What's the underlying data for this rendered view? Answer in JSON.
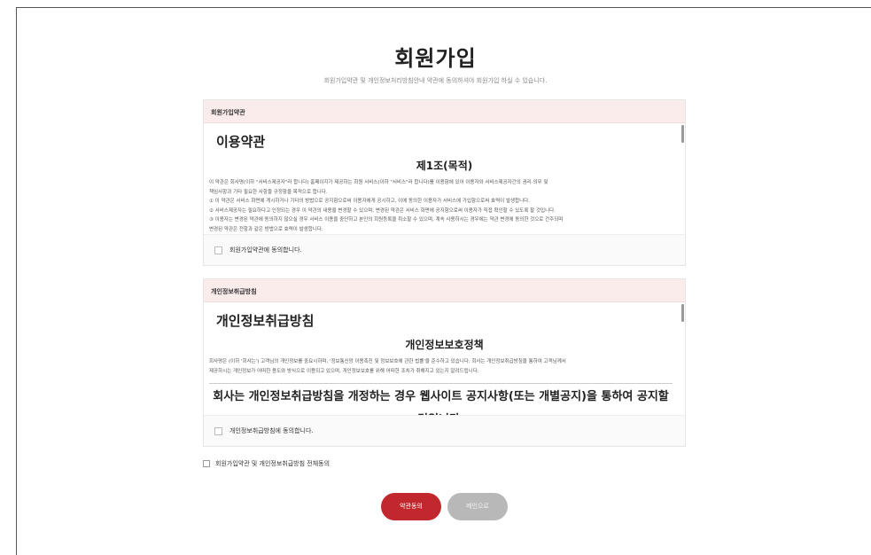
{
  "header": {
    "title": "회원가입",
    "subtitle": "회원가입약관 및 개인정보처리방침안내 약관에 동의하셔야 회원가입 하실 수 있습니다."
  },
  "terms": {
    "section_label": "회원가입약관",
    "doc_title": "이용약관",
    "article_title": "제1조(목적)",
    "lines": [
      "이 약관은 회사명(이하 \"서비스제공자\"라 합니다) 홈페이지가 제공하는 회원 서비스(이하 \"서비스\"라 합니다)를 이용함에 있어 이용자와 서비스제공자간의 권리·의무 및",
      "책임사항과 기타 필요한 사항을 규정함을 목적으로 합니다.",
      "① 이 약관은 서비스 화면에 게시하거나 기타의 방법으로 공지함으로써 이용자에게 공시하고, 이에 동의한 이용자가 서비스에 가입함으로써 효력이 발생합니다.",
      "② 서비스제공자는 필요하다고 인정되는 경우 이 약관의 내용을 변경할 수 있으며, 변경된 약관은 서비스 화면에 공지함으로써 이용자가 직접 확인할 수 있도록 할 것입니다.",
      "③ 이용자는 변경된 약관에 동의하지 않으실 경우 서비스 이용을 중단하고 본인의 회원등록을 취소할 수 있으며, 계속 사용하시는 경우에는 약관 변경에 동의한 것으로 간주되며",
      "변경된 약관은 전항과 같은 방법으로 효력이 발생합니다."
    ],
    "agree_label": "회원가입약관에 동의합니다."
  },
  "privacy": {
    "section_label": "개인정보취급방침",
    "doc_title": "개인정보취급방침",
    "article_title": "개인정보보호정책",
    "lines": [
      "회사명은 (이하 '회사는') 고객님의 개인정보를 중요시하며, '정보통신망 이용촉진 및 정보보호에 관한 법률'을 준수하고 있습니다. 회사는 개인정보취급방침을 통하여 고객님께서",
      "제공하시는 개인정보가 어떠한 용도와 방식으로 이용되고 있으며, 개인정보보호를 위해 어떠한 조치가 취해지고 있는지 알려드립니다."
    ],
    "big_notice": "회사는 개인정보취급방침을 개정하는 경우 웹사이트 공지사항(또는 개별공지)을 통하여 공지할 것입니다.",
    "agree_label": "개인정보취급방침에 동의합니다."
  },
  "all_agree_label": "회원가입약관 및 개인정보취급방침 전체동의",
  "buttons": {
    "agree": "약관동의",
    "back": "메인으로"
  },
  "colors": {
    "primary": "#c0282d",
    "secondary": "#b8b8b8",
    "section_header_bg": "#fbecec"
  }
}
